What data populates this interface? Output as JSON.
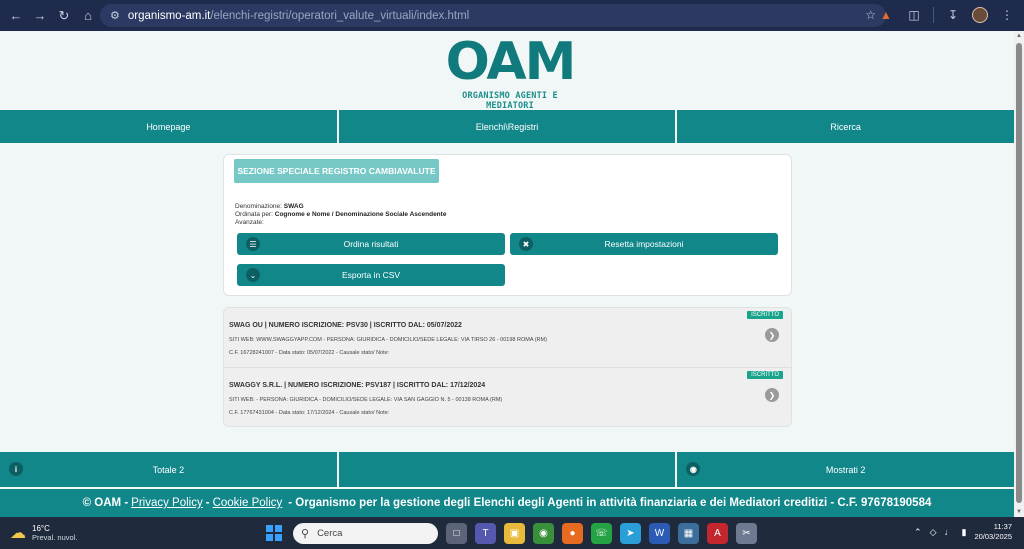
{
  "browser": {
    "url_host": "organismo-am.it",
    "url_path": "/elenchi-registri/operatori_valute_virtuali/index.html"
  },
  "logo": {
    "mark": "OAM",
    "subtitle": "ORGANISMO AGENTI E MEDIATORI"
  },
  "menu": {
    "items": [
      "Homepage",
      "Elenchi\\Registri",
      "Ricerca"
    ]
  },
  "search_panel": {
    "section_label": "SEZIONE SPECIALE REGISTRO CAMBIAVALUTE",
    "denominazione_label": "Denominazione:",
    "denominazione_value": "SWAG",
    "ordinata_label": "Ordinata per:",
    "ordinata_value": "Cognome e Nome / Denominazione Sociale Ascendente",
    "avanzate_label": "Avanzate:",
    "btn_ordina": "Ordina risultati",
    "btn_resetta": "Resetta impostazioni",
    "btn_esporta": "Esporta in CSV"
  },
  "results": [
    {
      "badge": "ISCRITTO",
      "title": "SWAG OU | NUMERO ISCRIZIONE: PSV30 | ISCRITTO DAL: 05/07/2022",
      "line2": "SITI WEB: WWW.SWAGGYAPP.COM - PERSONA: GIURIDICA - DOMICILIO/SEDE LEGALE: VIA TIRSO 26 - 00198 ROMA (RM)",
      "line3": "C.F. 16728241007 - Data stato: 05/07/2022 - Causale stato/ Note:"
    },
    {
      "badge": "ISCRITTO",
      "title": "SWAGGY S.R.L. | NUMERO ISCRIZIONE: PSV187 | ISCRITTO DAL: 17/12/2024",
      "line2": "SITI WEB: - PERSONA: GIURIDICA - DOMICILIO/SEDE LEGALE: VIA SAN GAGGIO N. 5 - 00138 ROMA (RM)",
      "line3": "C.F. 17767431004 - Data stato: 17/12/2024 - Causale stato/ Note:"
    }
  ],
  "totals": {
    "totale": "Totale 2",
    "mostrati": "Mostrati 2"
  },
  "footer": {
    "copyright": "© OAM -",
    "privacy": "Privacy Policy",
    "dash1": "-",
    "cookie": "Cookie Policy",
    "rest": "- Organismo per la gestione degli Elenchi degli Agenti in attività finanziaria e dei Mediatori creditizi - C.F. 97678190584"
  },
  "taskbar": {
    "temp": "16°C",
    "weather": "Preval. nuvol.",
    "search": "Cerca",
    "time": "11:37",
    "date": "20/03/2025"
  },
  "colors": {
    "teal": "#11878a",
    "teal_light": "#76c8c6",
    "badge": "#19a38a"
  }
}
